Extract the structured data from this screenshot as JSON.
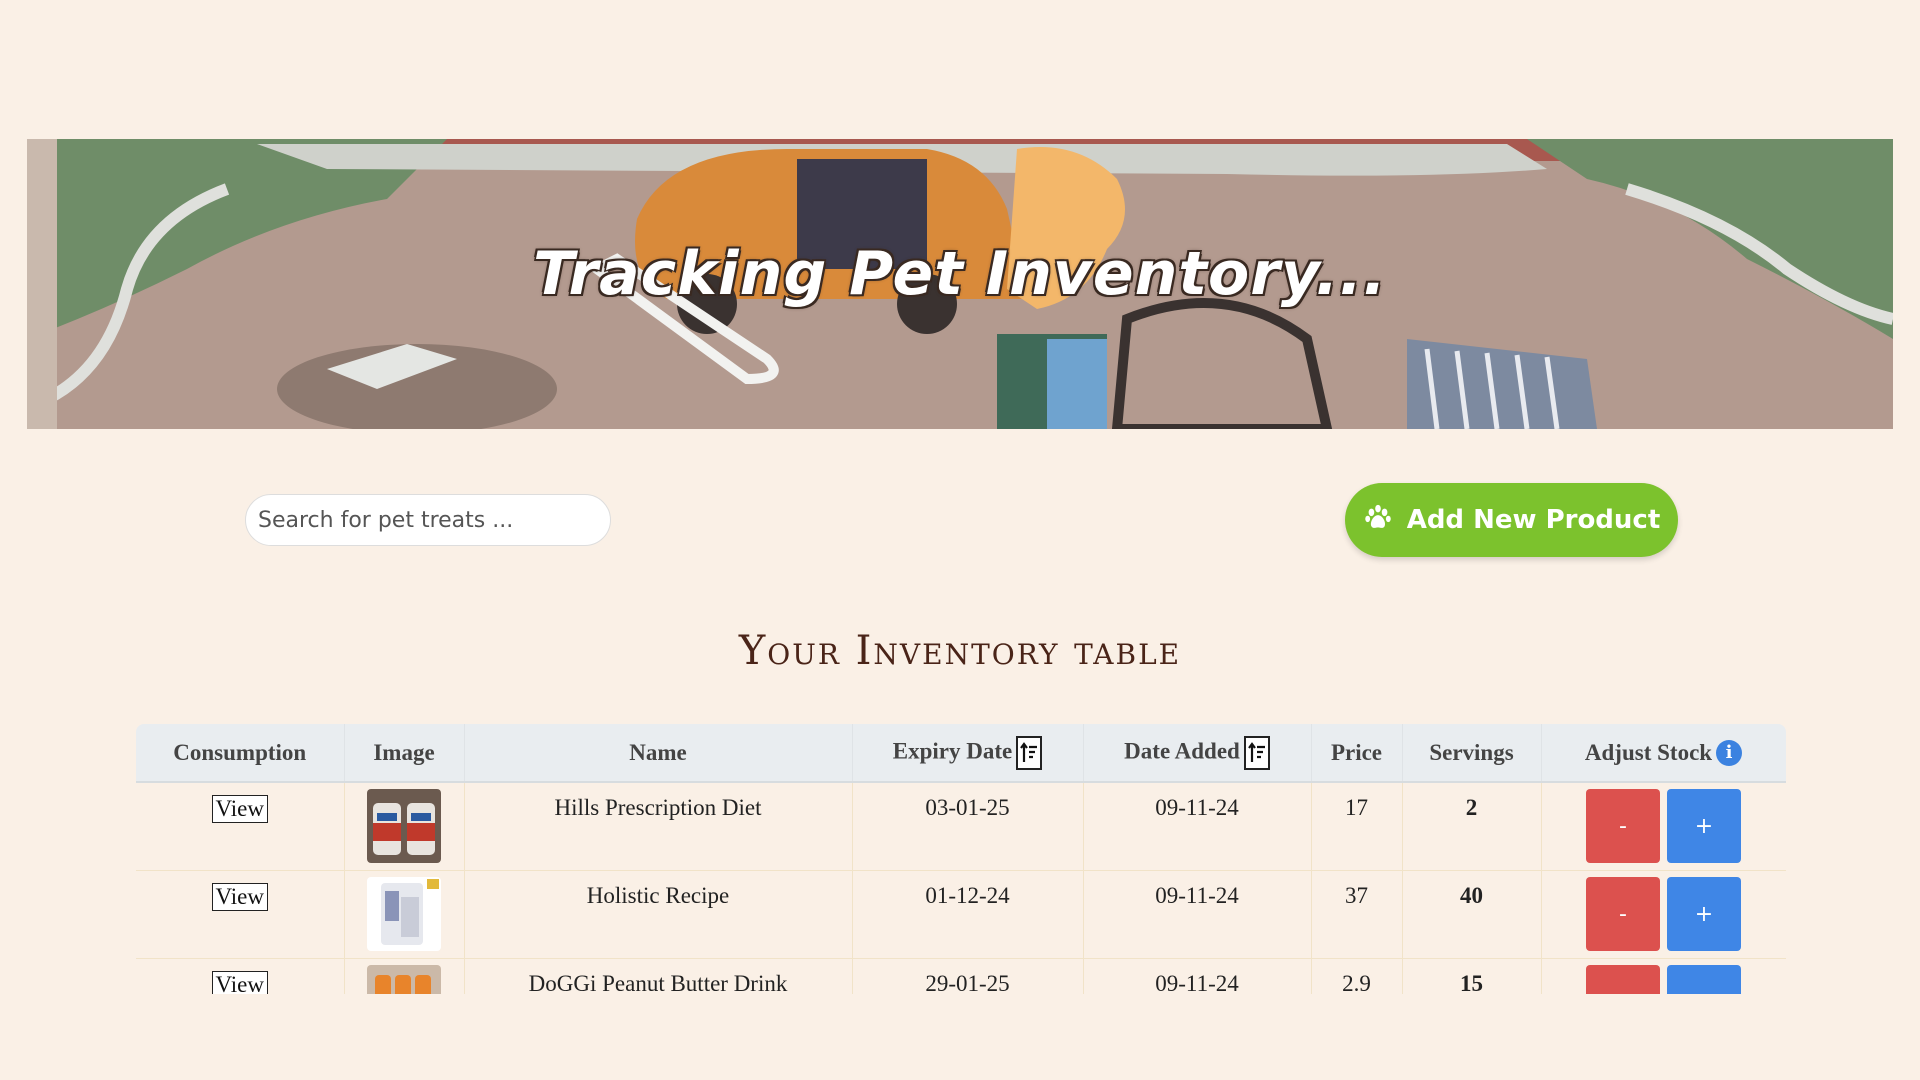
{
  "banner": {
    "title": "Tracking Pet Inventory..."
  },
  "search": {
    "placeholder": "Search for pet treats ..."
  },
  "add_button": {
    "label": "Add New Product",
    "icon": "paw-icon"
  },
  "heading": "Your Inventory table",
  "table": {
    "columns": [
      "Consumption",
      "Image",
      "Name",
      "Expiry Date",
      "Date Added",
      "Price",
      "Servings",
      "Adjust Stock"
    ],
    "rows": [
      {
        "view": "View",
        "name": "Hills Prescription Diet",
        "expiry": "03-01-25",
        "added": "09-11-24",
        "price": "17",
        "servings": "2",
        "minus": "-",
        "plus": "+"
      },
      {
        "view": "View",
        "name": "Holistic Recipe",
        "expiry": "01-12-24",
        "added": "09-11-24",
        "price": "37",
        "servings": "40",
        "minus": "-",
        "plus": "+"
      },
      {
        "view": "View",
        "name": "DoGGi Peanut Butter Drink",
        "expiry": "29-01-25",
        "added": "09-11-24",
        "price": "2.9",
        "servings": "15",
        "minus": "-",
        "plus": "+"
      }
    ]
  },
  "colors": {
    "background": "#faf0e6",
    "add_button": "#7cc22d",
    "minus": "#dc514e",
    "plus": "#3f86e6",
    "heading": "#4a2418"
  }
}
